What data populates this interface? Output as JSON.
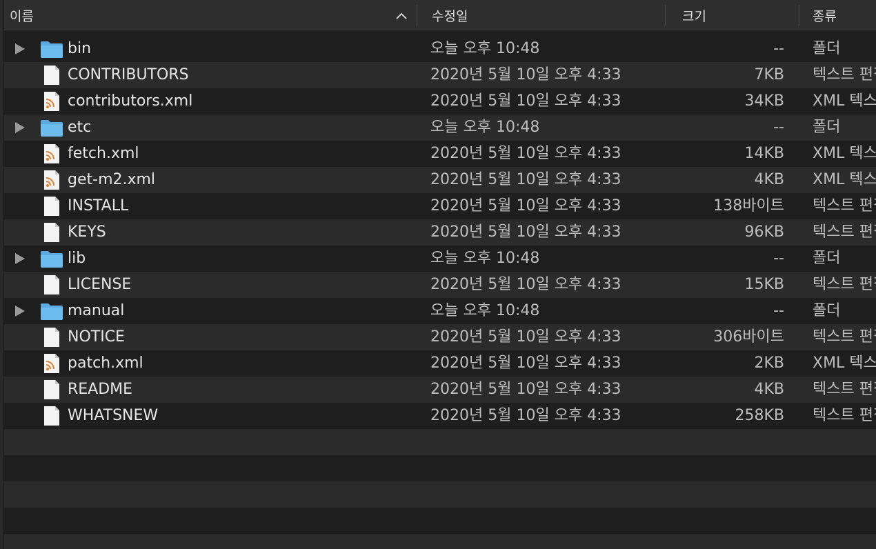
{
  "header": {
    "name_label": "이름",
    "modified_label": "수정일",
    "size_label": "크기",
    "kind_label": "종류"
  },
  "rows": [
    {
      "name": "bin",
      "type": "folder",
      "modified": "오늘 오후 10:48",
      "size": "--",
      "kind": "폴더"
    },
    {
      "name": "CONTRIBUTORS",
      "type": "text",
      "modified": "2020년 5월 10일 오후 4:33",
      "size": "7KB",
      "kind": "텍스트 편집"
    },
    {
      "name": "contributors.xml",
      "type": "xml",
      "modified": "2020년 5월 10일 오후 4:33",
      "size": "34KB",
      "kind": "XML 텍스트"
    },
    {
      "name": "etc",
      "type": "folder",
      "modified": "오늘 오후 10:48",
      "size": "--",
      "kind": "폴더"
    },
    {
      "name": "fetch.xml",
      "type": "xml",
      "modified": "2020년 5월 10일 오후 4:33",
      "size": "14KB",
      "kind": "XML 텍스트"
    },
    {
      "name": "get-m2.xml",
      "type": "xml",
      "modified": "2020년 5월 10일 오후 4:33",
      "size": "4KB",
      "kind": "XML 텍스트"
    },
    {
      "name": "INSTALL",
      "type": "text",
      "modified": "2020년 5월 10일 오후 4:33",
      "size": "138바이트",
      "kind": "텍스트 편집"
    },
    {
      "name": "KEYS",
      "type": "text",
      "modified": "2020년 5월 10일 오후 4:33",
      "size": "96KB",
      "kind": "텍스트 편집"
    },
    {
      "name": "lib",
      "type": "folder",
      "modified": "오늘 오후 10:48",
      "size": "--",
      "kind": "폴더"
    },
    {
      "name": "LICENSE",
      "type": "text",
      "modified": "2020년 5월 10일 오후 4:33",
      "size": "15KB",
      "kind": "텍스트 편집"
    },
    {
      "name": "manual",
      "type": "folder",
      "modified": "오늘 오후 10:48",
      "size": "--",
      "kind": "폴더"
    },
    {
      "name": "NOTICE",
      "type": "text",
      "modified": "2020년 5월 10일 오후 4:33",
      "size": "306바이트",
      "kind": "텍스트 편집"
    },
    {
      "name": "patch.xml",
      "type": "xml",
      "modified": "2020년 5월 10일 오후 4:33",
      "size": "2KB",
      "kind": "XML 텍스트"
    },
    {
      "name": "README",
      "type": "text",
      "modified": "2020년 5월 10일 오후 4:33",
      "size": "4KB",
      "kind": "텍스트 편집"
    },
    {
      "name": "WHATSNEW",
      "type": "text",
      "modified": "2020년 5월 10일 오후 4:33",
      "size": "258KB",
      "kind": "텍스트 편집"
    }
  ],
  "colors": {
    "background": "#1e1e1e",
    "row_alt": "#2b2b2b",
    "folder": "#5aa9e0",
    "rss": "#e0822a"
  },
  "icons": {
    "folder": "folder-icon",
    "text": "text-document-icon",
    "xml": "xml-document-icon",
    "disclosure": "disclosure-triangle-icon",
    "sort": "sort-ascending-chevron-icon"
  }
}
